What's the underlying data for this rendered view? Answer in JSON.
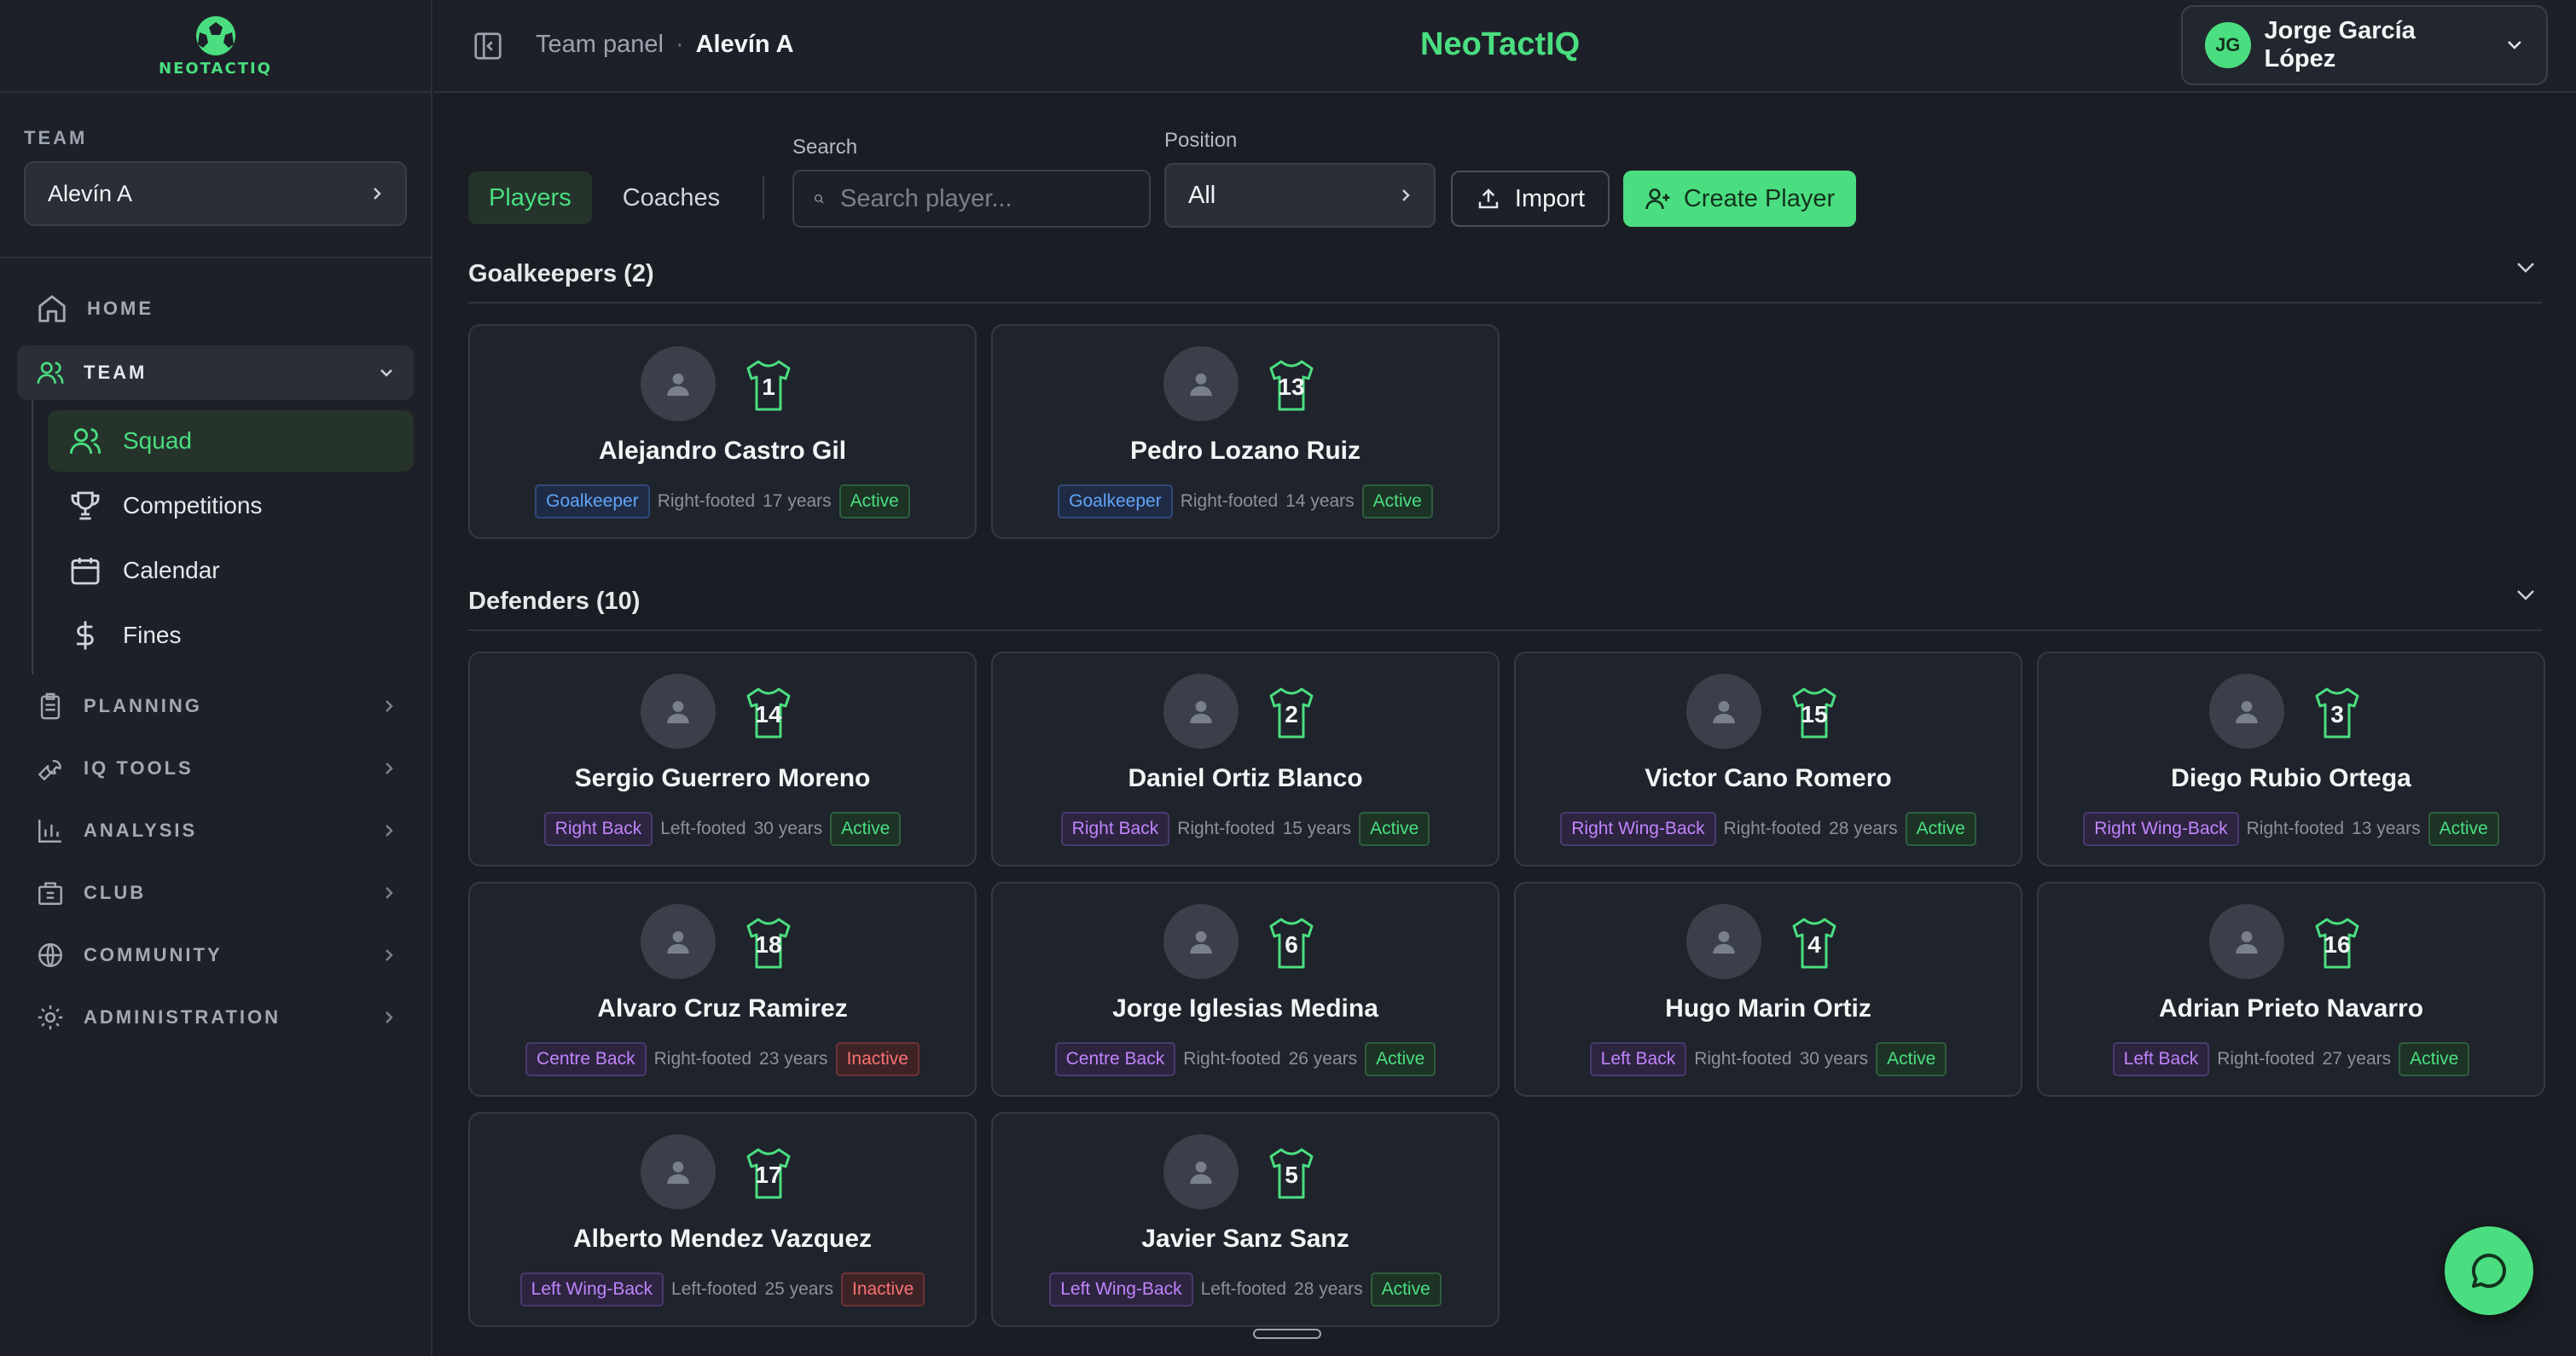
{
  "sidebar": {
    "logo_text": "NEOTACTIQ",
    "team_label": "TEAM",
    "team_select_value": "Alevín A",
    "nav": {
      "home": "HOME",
      "team": "TEAM",
      "team_sub": [
        {
          "label": "Squad",
          "icon": "users-icon",
          "active": true
        },
        {
          "label": "Competitions",
          "icon": "trophy-icon",
          "active": false
        },
        {
          "label": "Calendar",
          "icon": "calendar-icon",
          "active": false
        },
        {
          "label": "Fines",
          "icon": "dollar-icon",
          "active": false
        }
      ],
      "groups": [
        {
          "label": "PLANNING",
          "icon": "clipboard-icon"
        },
        {
          "label": "IQ TOOLS",
          "icon": "wrench-icon"
        },
        {
          "label": "ANALYSIS",
          "icon": "bar-chart-icon"
        },
        {
          "label": "CLUB",
          "icon": "building-icon"
        },
        {
          "label": "COMMUNITY",
          "icon": "globe-icon"
        },
        {
          "label": "ADMINISTRATION",
          "icon": "settings-icon"
        }
      ]
    }
  },
  "header": {
    "breadcrumb": [
      "Team panel",
      "Alevín A"
    ],
    "separator": "·",
    "brand": "NeoTactIQ",
    "user": {
      "initials": "JG",
      "name": "Jorge García López"
    }
  },
  "toolbar": {
    "tabs": [
      {
        "label": "Players",
        "active": true
      },
      {
        "label": "Coaches",
        "active": false
      }
    ],
    "search_label": "Search",
    "search_placeholder": "Search player...",
    "position_label": "Position",
    "position_value": "All",
    "import_label": "Import",
    "create_label": "Create Player"
  },
  "sections": [
    {
      "title": "Goalkeepers (2)",
      "players": [
        {
          "number": "1",
          "name": "Alejandro Castro Gil",
          "position": "Goalkeeper",
          "foot": "Right-footed",
          "age": "17 years",
          "status": "Active"
        },
        {
          "number": "13",
          "name": "Pedro Lozano Ruiz",
          "position": "Goalkeeper",
          "foot": "Right-footed",
          "age": "14 years",
          "status": "Active"
        }
      ]
    },
    {
      "title": "Defenders (10)",
      "players": [
        {
          "number": "14",
          "name": "Sergio Guerrero Moreno",
          "position": "Right Back",
          "foot": "Left-footed",
          "age": "30 years",
          "status": "Active"
        },
        {
          "number": "2",
          "name": "Daniel Ortiz Blanco",
          "position": "Right Back",
          "foot": "Right-footed",
          "age": "15 years",
          "status": "Active"
        },
        {
          "number": "15",
          "name": "Victor Cano Romero",
          "position": "Right Wing-Back",
          "foot": "Right-footed",
          "age": "28 years",
          "status": "Active"
        },
        {
          "number": "3",
          "name": "Diego Rubio Ortega",
          "position": "Right Wing-Back",
          "foot": "Right-footed",
          "age": "13 years",
          "status": "Active"
        },
        {
          "number": "18",
          "name": "Alvaro Cruz Ramirez",
          "position": "Centre Back",
          "foot": "Right-footed",
          "age": "23 years",
          "status": "Inactive"
        },
        {
          "number": "6",
          "name": "Jorge Iglesias Medina",
          "position": "Centre Back",
          "foot": "Right-footed",
          "age": "26 years",
          "status": "Active"
        },
        {
          "number": "4",
          "name": "Hugo Marin Ortiz",
          "position": "Left Back",
          "foot": "Right-footed",
          "age": "30 years",
          "status": "Active"
        },
        {
          "number": "16",
          "name": "Adrian Prieto Navarro",
          "position": "Left Back",
          "foot": "Right-footed",
          "age": "27 years",
          "status": "Active"
        },
        {
          "number": "17",
          "name": "Alberto Mendez Vazquez",
          "position": "Left Wing-Back",
          "foot": "Left-footed",
          "age": "25 years",
          "status": "Inactive"
        },
        {
          "number": "5",
          "name": "Javier Sanz Sanz",
          "position": "Left Wing-Back",
          "foot": "Left-footed",
          "age": "28 years",
          "status": "Active"
        }
      ]
    }
  ],
  "colors": {
    "accent": "#4ade80",
    "background": "#1a1d24",
    "sidebar": "#1d2028"
  }
}
